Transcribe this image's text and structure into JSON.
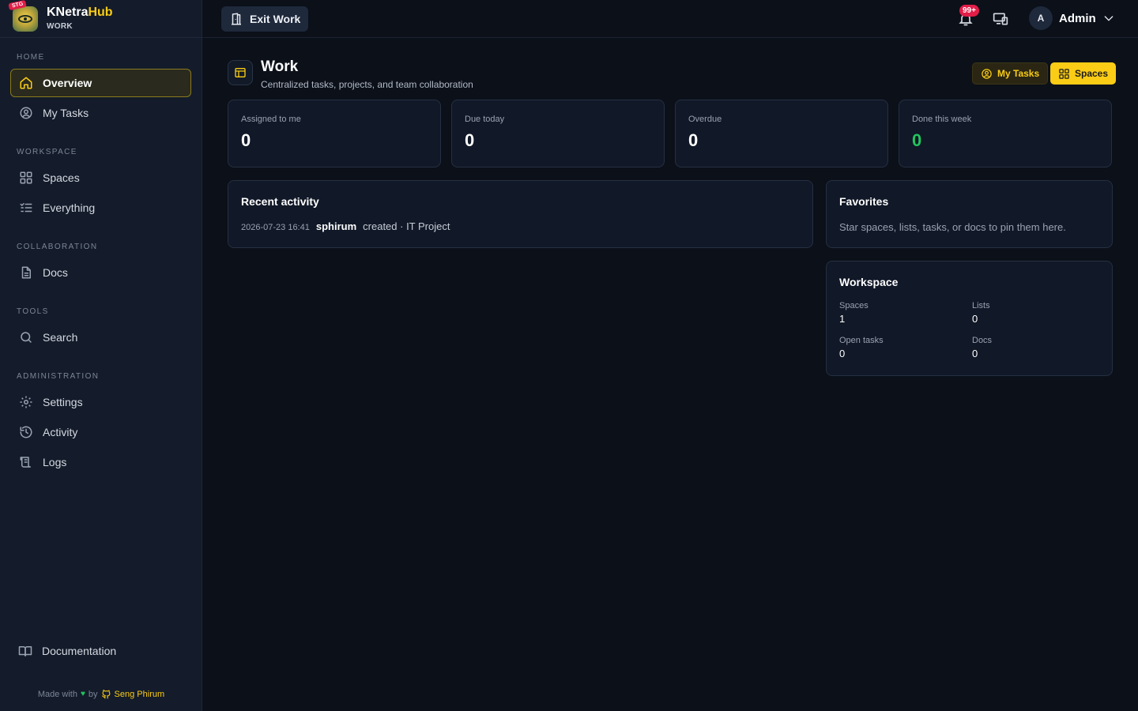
{
  "brand": {
    "name_main": "KNetra",
    "name_accent": "Hub",
    "sub": "WORK",
    "env_badge": "STG"
  },
  "sidebar": {
    "sections": [
      {
        "title": "HOME",
        "items": [
          {
            "label": "Overview",
            "icon": "home-icon",
            "active": true
          },
          {
            "label": "My Tasks",
            "icon": "user-circle-icon"
          }
        ]
      },
      {
        "title": "WORKSPACE",
        "items": [
          {
            "label": "Spaces",
            "icon": "grid-icon"
          },
          {
            "label": "Everything",
            "icon": "list-check-icon"
          }
        ]
      },
      {
        "title": "COLLABORATION",
        "items": [
          {
            "label": "Docs",
            "icon": "document-icon"
          }
        ]
      },
      {
        "title": "TOOLS",
        "items": [
          {
            "label": "Search",
            "icon": "search-icon"
          }
        ]
      },
      {
        "title": "ADMINISTRATION",
        "items": [
          {
            "label": "Settings",
            "icon": "gear-icon"
          },
          {
            "label": "Activity",
            "icon": "history-icon"
          },
          {
            "label": "Logs",
            "icon": "scroll-icon"
          }
        ]
      }
    ],
    "documentation": "Documentation",
    "credit": {
      "made_with": "Made with",
      "by": "by",
      "author": "Seng Phirum"
    }
  },
  "topbar": {
    "exit_label": "Exit Work",
    "notifications_badge": "99+",
    "user_initial": "A",
    "user_name": "Admin"
  },
  "page": {
    "title": "Work",
    "subtitle": "Centralized tasks, projects, and team collaboration",
    "my_tasks_button": "My Tasks",
    "spaces_button": "Spaces"
  },
  "stats": [
    {
      "label": "Assigned to me",
      "value": "0"
    },
    {
      "label": "Due today",
      "value": "0"
    },
    {
      "label": "Overdue",
      "value": "0"
    },
    {
      "label": "Done this week",
      "value": "0"
    }
  ],
  "recent_activity": {
    "title": "Recent activity",
    "items": [
      {
        "time": "2026-07-23 16:41",
        "user": "sphirum",
        "action": "created · IT Project"
      }
    ]
  },
  "favorites": {
    "title": "Favorites",
    "empty": "Star spaces, lists, tasks, or docs to pin them here."
  },
  "workspace": {
    "title": "Workspace",
    "spaces_label": "Spaces",
    "spaces_value": "1",
    "lists_label": "Lists",
    "lists_value": "0",
    "open_tasks_label": "Open tasks",
    "open_tasks_value": "0",
    "docs_label": "Docs",
    "docs_value": "0"
  },
  "colors": {
    "accent": "#facc15",
    "success": "#22c55e",
    "danger": "#e11d48",
    "background": "#0b1019",
    "sidebar": "#141c2b"
  }
}
